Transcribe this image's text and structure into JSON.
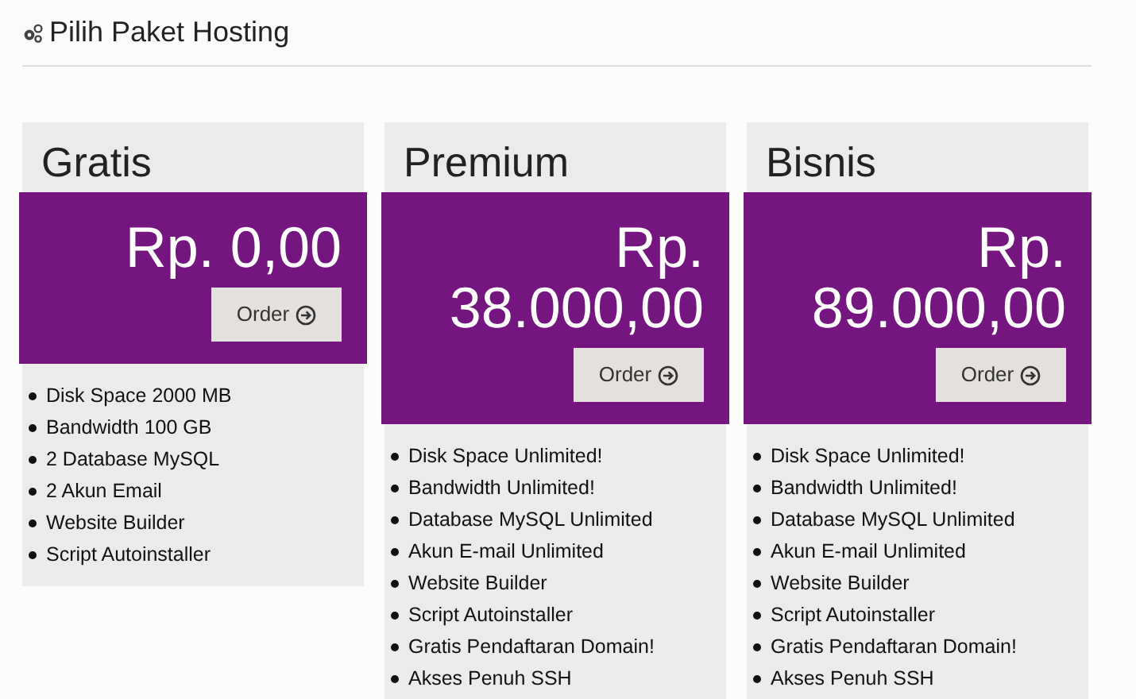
{
  "heading": "Pilih Paket Hosting",
  "plans": [
    {
      "name": "Gratis",
      "price": "Rp. 0,00",
      "button": "Order",
      "features": [
        "Disk Space 2000 MB",
        "Bandwidth 100 GB",
        "2 Database MySQL",
        "2 Akun Email",
        "Website Builder",
        "Script Autoinstaller"
      ]
    },
    {
      "name": "Premium",
      "price": "Rp. 38.000,00",
      "button": "Order",
      "features": [
        "Disk Space Unlimited!",
        "Bandwidth Unlimited!",
        "Database MySQL Unlimited",
        "Akun E-mail Unlimited",
        "Website Builder",
        "Script Autoinstaller",
        "Gratis Pendaftaran Domain!",
        "Akses Penuh SSH"
      ]
    },
    {
      "name": "Bisnis",
      "price": "Rp. 89.000,00",
      "button": "Order",
      "features": [
        "Disk Space Unlimited!",
        "Bandwidth Unlimited!",
        "Database MySQL Unlimited",
        "Akun E-mail Unlimited",
        "Website Builder",
        "Script Autoinstaller",
        "Gratis Pendaftaran Domain!",
        "Akses Penuh SSH"
      ]
    }
  ]
}
